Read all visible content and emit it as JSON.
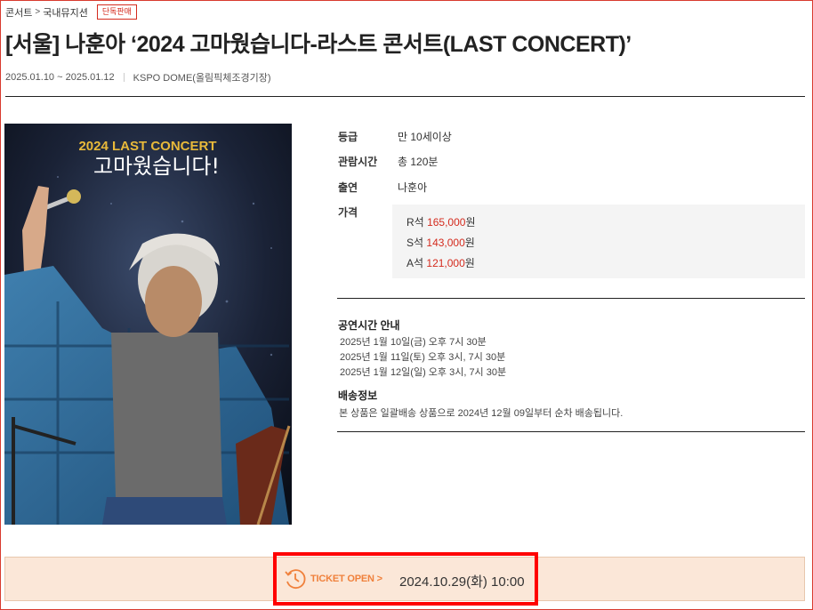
{
  "breadcrumb": {
    "items": [
      "콘서트",
      "국내뮤지션"
    ],
    "separator": ">"
  },
  "badge": "단독판매",
  "title": "[서울] 나훈아 ‘2024 고마웠습니다-라스트 콘서트(LAST CONCERT)’",
  "meta": {
    "dates": "2025.01.10 ~ 2025.01.12",
    "venue": "KSPO DOME(올림픽체조경기장)"
  },
  "poster": {
    "headline": "2024 LAST CONCERT",
    "subtitle": "고마웠습니다!"
  },
  "info": {
    "rating_label": "등급",
    "rating_value": "만 10세이상",
    "duration_label": "관람시간",
    "duration_value": "총 120분",
    "cast_label": "출연",
    "cast_value": "나훈아",
    "price_label": "가격"
  },
  "prices": [
    {
      "seat": "R석",
      "amount": "165,000",
      "unit": "원"
    },
    {
      "seat": "S석",
      "amount": "143,000",
      "unit": "원"
    },
    {
      "seat": "A석",
      "amount": "121,000",
      "unit": "원"
    }
  ],
  "schedule": {
    "heading": "공연시간 안내",
    "lines": [
      "2025년 1월 10일(금) 오후 7시 30분",
      "2025년 1월 11일(토) 오후 3시, 7시 30분",
      "2025년 1월 12일(일) 오후 3시, 7시 30분"
    ]
  },
  "shipping": {
    "heading": "배송정보",
    "text": "본 상품은 일괄배송 상품으로 2024년 12월 09일부터 순차 배송됩니다."
  },
  "ticket_open": {
    "label": "TICKET OPEN >",
    "datetime": "2024.10.29(화) 10:00"
  },
  "colors": {
    "accent_red": "#d42b1e",
    "open_orange": "#f0813c",
    "open_bg": "#fbe7d8",
    "highlight": "#ff0000"
  }
}
